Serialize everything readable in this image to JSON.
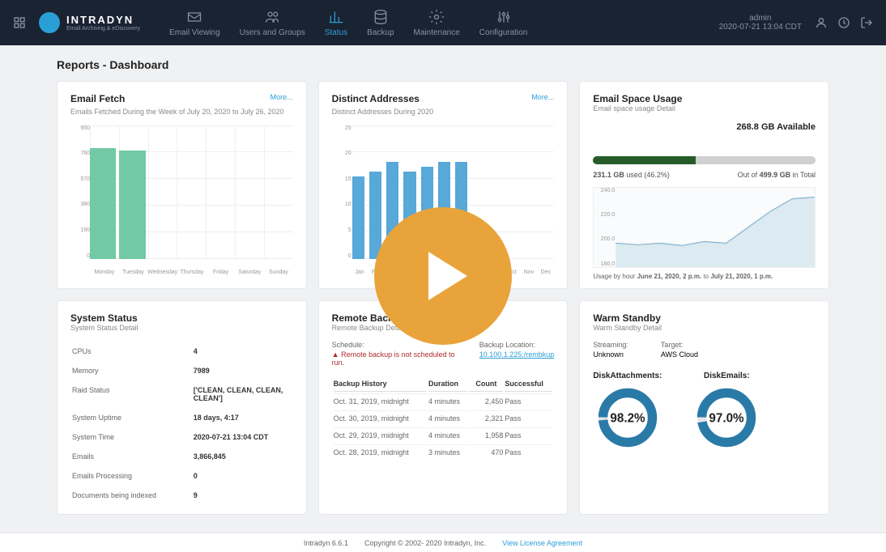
{
  "brand": {
    "name": "INTRADYN",
    "tagline": "Email Archiving & eDiscovery"
  },
  "nav": {
    "items": [
      {
        "label": "Email Viewing"
      },
      {
        "label": "Users and Groups"
      },
      {
        "label": "Status",
        "active": true
      },
      {
        "label": "Backup"
      },
      {
        "label": "Maintenance"
      },
      {
        "label": "Configuration"
      }
    ]
  },
  "user": {
    "name": "admin",
    "timestamp": "2020-07-21 13:04 CDT"
  },
  "page": {
    "title": "Reports - Dashboard"
  },
  "cards": {
    "email_fetch": {
      "title": "Email Fetch",
      "subtitle": "Emails Fetched During the Week of July 20, 2020 to July 26, 2020",
      "more": "More..."
    },
    "distinct": {
      "title": "Distinct Addresses",
      "subtitle": "Distinct Addresses During 2020",
      "more": "More..."
    },
    "space": {
      "title": "Email Space Usage",
      "subtitle": "Email space usage Detail",
      "available": "268.8 GB Available",
      "used_line_a": "231.1 GB",
      "used_line_b": " used (46.2%)",
      "total_line_a": "Out of ",
      "total_line_b": "499.9 GB",
      "total_line_c": " in Total",
      "usage_caption_a": "Usage by hour ",
      "usage_caption_b": "June 21, 2020, 2 p.m.",
      "usage_caption_c": " to ",
      "usage_caption_d": "July 21, 2020, 1 p.m."
    },
    "system_status": {
      "title": "System Status",
      "subtitle": "System Status Detail",
      "rows": {
        "cpus": {
          "k": "CPUs",
          "v": "4"
        },
        "memory": {
          "k": "Memory",
          "v": "7989"
        },
        "raid": {
          "k": "Raid Status",
          "v": "['CLEAN, CLEAN, CLEAN, CLEAN']"
        },
        "uptime": {
          "k": "System Uptime",
          "v": "18 days, 4:17"
        },
        "time": {
          "k": "System Time",
          "v": "2020-07-21 13:04 CDT"
        },
        "emails": {
          "k": "Emails",
          "v": "3,866,845"
        },
        "processing": {
          "k": "Emails Processing",
          "v": "0"
        },
        "indexed": {
          "k": "Documents being indexed",
          "v": "9"
        }
      }
    },
    "remote_backup": {
      "title": "Remote Backup",
      "subtitle": "Remote Backup Detail",
      "schedule_label": "Schedule:",
      "schedule_text": "Remote backup is not scheduled to run.",
      "location_label": "Backup Location:",
      "location_value": "10.100.1.225:/rembkup",
      "headers": {
        "history": "Backup History",
        "duration": "Duration",
        "count": "Count",
        "success": "Successful"
      },
      "rows": {
        "r0": {
          "date": "Oct. 31, 2019, midnight",
          "duration": "4 minutes",
          "count": "2,450",
          "success": "Pass"
        },
        "r1": {
          "date": "Oct. 30, 2019, midnight",
          "duration": "4 minutes",
          "count": "2,321",
          "success": "Pass"
        },
        "r2": {
          "date": "Oct. 29, 2019, midnight",
          "duration": "4 minutes",
          "count": "1,958",
          "success": "Pass"
        },
        "r3": {
          "date": "Oct. 28, 2019, midnight",
          "duration": "3 minutes",
          "count": "470",
          "success": "Pass"
        }
      }
    },
    "warm_standby": {
      "title": "Warm Standby",
      "subtitle": "Warm Standby Detail",
      "streaming_label": "Streaming:",
      "streaming_value": "Unknown",
      "target_label": "Target:",
      "target_value": "AWS Cloud",
      "disk_attachments_label": "DiskAttachments:",
      "disk_attachments_value": "98.2%",
      "disk_emails_label": "DiskEmails:",
      "disk_emails_value": "97.0%"
    }
  },
  "chart_data": [
    {
      "type": "bar",
      "title": "Email Fetch",
      "categories": [
        "Monday",
        "Tuesday",
        "Wednesday",
        "Thursday",
        "Friday",
        "Saturday",
        "Sunday"
      ],
      "values": [
        870,
        850,
        0,
        0,
        0,
        0,
        0
      ],
      "ylim": [
        0,
        950
      ],
      "yticks": [
        0,
        190,
        380,
        570,
        760,
        950
      ],
      "color": "#72c9a3"
    },
    {
      "type": "bar",
      "title": "Distinct Addresses",
      "categories": [
        "Jan",
        "Feb",
        "Mar",
        "Apr",
        "May",
        "Jun",
        "Jul",
        "Aug",
        "Sep",
        "Oct",
        "Nov",
        "Dec"
      ],
      "values": [
        17,
        18,
        20,
        18,
        19,
        20,
        20,
        0,
        0,
        0,
        0,
        0
      ],
      "ylim": [
        0,
        25
      ],
      "yticks": [
        0,
        5,
        10,
        15,
        20,
        25
      ],
      "color": "#58a8d8"
    },
    {
      "type": "area",
      "title": "Email Space Usage",
      "x": "hours June 21 2020 2pm – July 21 2020 1pm",
      "ylim": [
        180,
        240
      ],
      "yticks": [
        180,
        200,
        220,
        240
      ],
      "values": [
        198,
        197,
        198,
        196,
        199,
        198,
        210,
        222,
        231,
        232
      ],
      "color": "#9dc4d8"
    }
  ],
  "footer": {
    "version": "Intradyn 6.6.1",
    "copyright": "Copyright © 2002- 2020 Intradyn, Inc.",
    "license": "View License Agreement"
  }
}
